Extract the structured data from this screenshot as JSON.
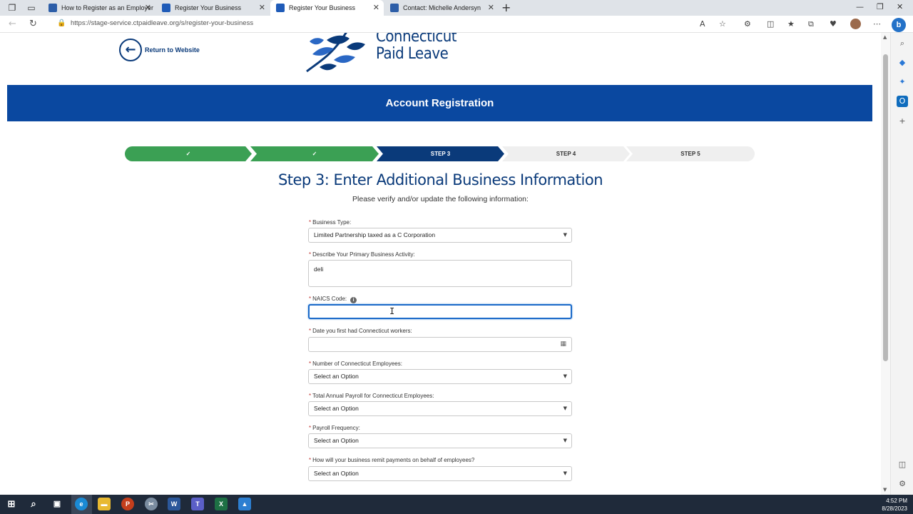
{
  "browser": {
    "tabs": [
      {
        "label": "How to Register as an Employer",
        "active": false
      },
      {
        "label": "Register Your Business",
        "active": false
      },
      {
        "label": "Register Your Business",
        "active": true
      },
      {
        "label": "Contact: Michelle Andersyn",
        "active": false
      }
    ],
    "url": "https://stage-service.ctpaidleave.org/s/register-your-business"
  },
  "page": {
    "return_link": "Return to Website",
    "logo_line1": "Connecticut",
    "logo_line2": "Paid Leave",
    "banner_title": "Account Registration",
    "steps": [
      {
        "label": "✓",
        "state": "done"
      },
      {
        "label": "✓",
        "state": "done"
      },
      {
        "label": "STEP 3",
        "state": "current"
      },
      {
        "label": "STEP 4",
        "state": "todo"
      },
      {
        "label": "STEP 5",
        "state": "todo"
      }
    ],
    "heading": "Step 3: Enter Additional Business Information",
    "subheading": "Please verify and/or update the following information:",
    "required_mark": "*",
    "fields": {
      "business_type": {
        "label": "Business Type:",
        "value": "Limited Partnership taxed as a C Corporation"
      },
      "activity": {
        "label": "Describe Your Primary Business Activity:",
        "value": "deli"
      },
      "naics": {
        "label": "NAICS Code:",
        "value": ""
      },
      "date_first": {
        "label": "Date you first had Connecticut workers:",
        "value": ""
      },
      "num_employees": {
        "label": "Number of Connecticut Employees:",
        "value": "Select an Option"
      },
      "annual_payroll": {
        "label": "Total Annual Payroll for Connecticut Employees:",
        "value": "Select an Option"
      },
      "payroll_frequency": {
        "label": "Payroll Frequency:",
        "value": "Select an Option"
      },
      "remit_payments": {
        "label": "How will your business remit payments on behalf of employees?",
        "value": "Select an Option"
      }
    }
  },
  "taskbar": {
    "time": "4:52 PM",
    "date": "8/28/2023"
  },
  "colors": {
    "banner_blue": "#0a48a0",
    "navy": "#0a3a7a",
    "step_done_green": "#3ba054",
    "required_red": "#c23934",
    "focus_blue": "#1b6ac9"
  }
}
